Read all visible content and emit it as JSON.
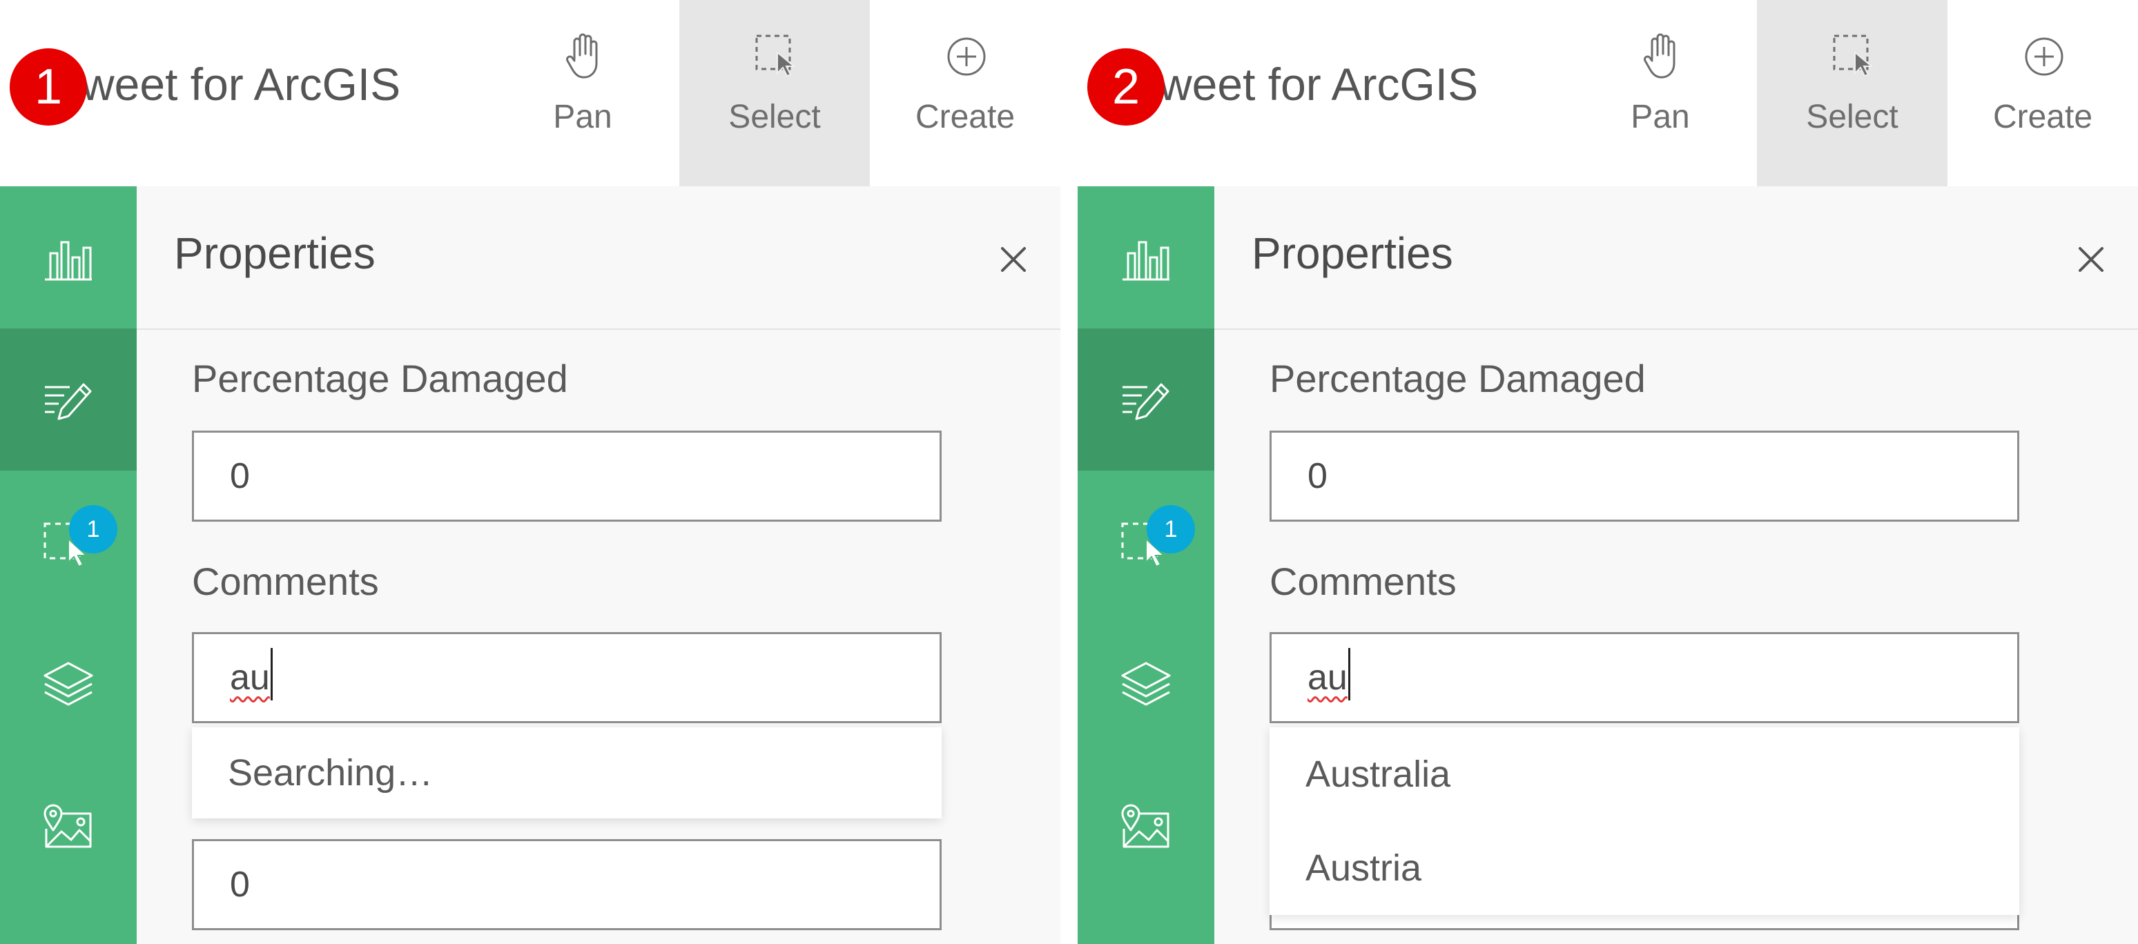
{
  "app_title": "weet for ArcGIS",
  "toolbar": {
    "pan_label": "Pan",
    "select_label": "Select",
    "create_label": "Create"
  },
  "sidebar": {
    "selection_count": "1"
  },
  "properties": {
    "title": "Properties",
    "close_symbol": "×",
    "percentage_damaged_label": "Percentage Damaged",
    "percentage_damaged_value": "0",
    "comments_label": "Comments",
    "comments_value": "au",
    "next_field_value": "0"
  },
  "panels": [
    {
      "step": "1",
      "dropdown": [
        "Searching…"
      ]
    },
    {
      "step": "2",
      "dropdown": [
        "Australia",
        "Austria"
      ]
    }
  ],
  "icons": [
    "hand-pan-icon",
    "select-box-icon",
    "plus-circle-icon",
    "chart-icon",
    "edit-icon",
    "selection-icon",
    "layers-icon",
    "basemap-icon",
    "close-icon"
  ],
  "colors": {
    "sidebar_green": "#4cb77c",
    "sidebar_active_green": "#3d9a66",
    "step_badge_red": "#e60000",
    "count_badge_blue": "#08a8d8",
    "select_tool_bg": "#e6e6e6"
  }
}
